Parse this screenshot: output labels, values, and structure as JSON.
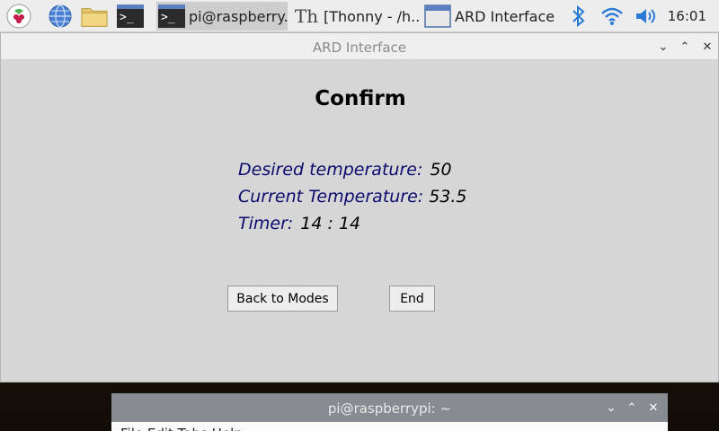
{
  "taskbar": {
    "tasks": [
      {
        "label": "pi@raspberry..."
      },
      {
        "label": "[Thonny  -  /h..."
      },
      {
        "label": "ARD Interface"
      }
    ],
    "clock": "16:01"
  },
  "window": {
    "title": "ARD Interface",
    "heading": "Confirm",
    "desired_label": "Desired temperature:",
    "desired_value": "50",
    "current_label": "Current Temperature:",
    "current_value": "53.5",
    "timer_label": "Timer:",
    "timer_value": "14 : 14",
    "back_button": "Back to Modes",
    "end_button": "End"
  },
  "terminal": {
    "title": "pi@raspberrypi: ~",
    "menu": "File  Edit  Tabs  Help"
  },
  "colors": {
    "label_color": "#0b0b6e",
    "window_bg": "#d6d6d6",
    "taskbar_bg": "#ededed"
  }
}
